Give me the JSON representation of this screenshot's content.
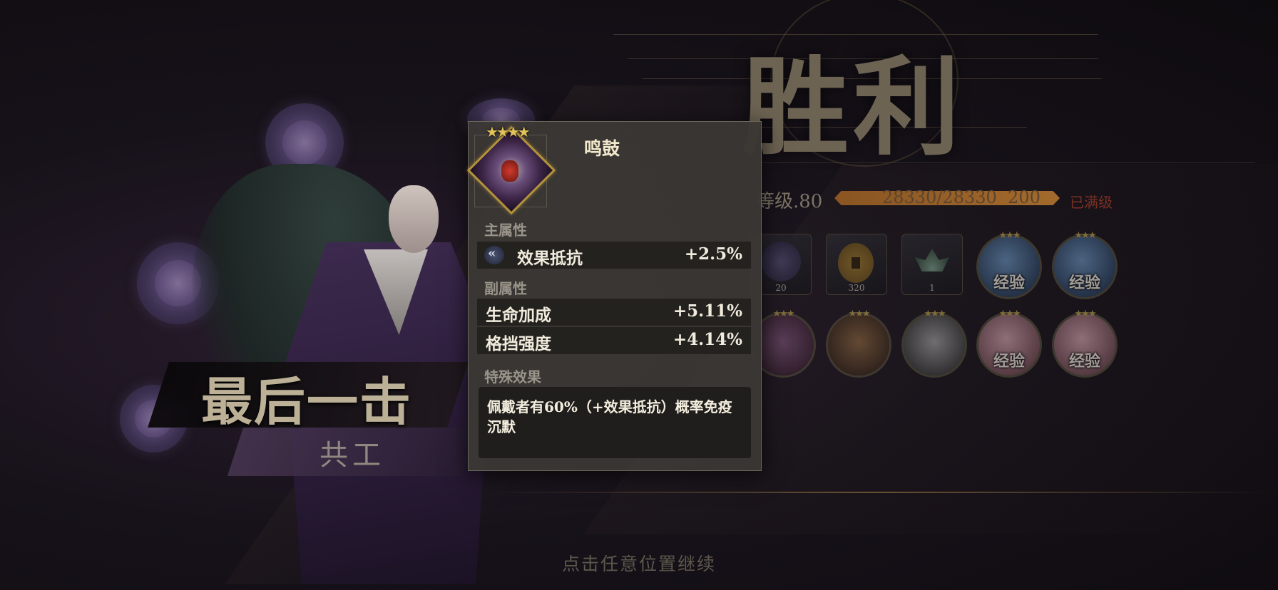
{
  "skill_banner": {
    "title": "最后一击",
    "name": "共工"
  },
  "victory": {
    "title": "胜利",
    "level_label": "等级.80",
    "exp_text": "28330/28330",
    "exp_gain": "200",
    "exp_progress": 1.0,
    "max_label": "已满级"
  },
  "rewards": [
    {
      "icon": "purple-gem-icon",
      "count": "20"
    },
    {
      "icon": "coin-icon",
      "count": "320"
    },
    {
      "icon": "lotus-icon",
      "count": "1"
    },
    {
      "icon": "exp-orb-blue-icon",
      "label": "经验"
    },
    {
      "icon": "exp-orb-blue-icon",
      "label": "经验"
    }
  ],
  "rewards_row2": [
    {
      "icon": "violet-beast-icon"
    },
    {
      "icon": "gold-beast-icon"
    },
    {
      "icon": "silver-beast-icon"
    },
    {
      "icon": "exp-orb-pink-icon",
      "label": "经验"
    },
    {
      "icon": "exp-orb-pink-icon",
      "label": "经验"
    }
  ],
  "tooltip": {
    "item_name": "鸣鼓",
    "item_stars": "★★★★",
    "main_attr_label": "主属性",
    "main_attr": {
      "name": "效果抵抗",
      "value": "+2.5%"
    },
    "sub_attr_label": "副属性",
    "sub_attrs": [
      {
        "name": "生命加成",
        "value": "+5.11%"
      },
      {
        "name": "格挡强度",
        "value": "+4.14%"
      }
    ],
    "special_label": "特殊效果",
    "special_text": "佩戴者有60%（+效果抵抗）概率免疫沉默"
  },
  "continue_hint": "点击任意位置继续",
  "colors": {
    "accent_gold": "#b3923c",
    "panel_bg": "#3a3734",
    "max_red": "#7a3024"
  }
}
